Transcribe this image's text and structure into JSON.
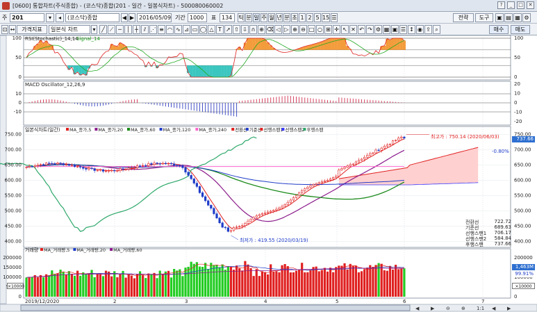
{
  "window": {
    "title": "[0600] 통합차트(주식종합) - (코스닥)종합(201 - 일간 - 일봉식차트) - 500080060002"
  },
  "toolbar1": {
    "market_label": "주",
    "code": "201",
    "name": "(코스닥)종합",
    "date": "2016/05/09",
    "period_label": "기간",
    "period_value": "1000",
    "count_label": "표",
    "count_value": "134",
    "intervals": [
      "틱",
      "분",
      "일",
      "주",
      "월",
      "년",
      "분",
      "초",
      "1",
      "2",
      "5",
      "15",
      "☰"
    ],
    "right_buttons": [
      "전략",
      "도구"
    ]
  },
  "toolbar2": {
    "sub_label1": "가격지표",
    "sub_label2": "일본식 차트",
    "right_buttons": [
      "매수",
      "매도"
    ]
  },
  "panes": {
    "rsi": {
      "title": "RSI(Stochastic)_14,14",
      "signal": "Signal_14",
      "ticks": [
        "100",
        "50",
        "0"
      ]
    },
    "macd": {
      "title": "MACD Oscillator_12,26,9",
      "ticks_left": [
        "10",
        "0",
        "-10"
      ],
      "ticks_right": [
        "20",
        "10",
        "0",
        "-10",
        "-20"
      ]
    },
    "price": {
      "title": "일본식차트(일간)",
      "legend": [
        "MA_종가,5",
        "MA_종가,20",
        "MA_종가,60",
        "MA_종가,120",
        "MA_종가,240",
        "전환선",
        "기준선",
        "선행스팬1",
        "선행스팬2",
        "후행스팬"
      ],
      "ticks": [
        "750.00",
        "700.00",
        "650.00",
        "600.00",
        "550.00",
        "500.00",
        "450.00",
        "400.00"
      ],
      "high_label": "최고가 : 750.14 (2020/06/03)",
      "low_label": "최저가 : 419.55 (2020/03/19)",
      "current_price": "737.66",
      "change_pct": "-0.80%"
    },
    "volume": {
      "title": "거래량",
      "legend": [
        "MA_거래량,5",
        "MA_거래량,20",
        "MA_거래량,60"
      ],
      "ticks": [
        "200000",
        "150000",
        "100000",
        "50000",
        "0"
      ],
      "unit": "×10000",
      "current_volume": "1,463M",
      "volume_pct": "99.91%"
    }
  },
  "ichimoku_values": [
    {
      "label": "전환선",
      "value": "722.72"
    },
    {
      "label": "기준선",
      "value": "689.63"
    },
    {
      "label": "선행스팬1",
      "value": "706.17"
    },
    {
      "label": "선행스팬2",
      "value": "584.84"
    },
    {
      "label": "후행스팬",
      "value": "737.66"
    }
  ],
  "xaxis": {
    "start": "2019/12/2020",
    "months": [
      "2",
      "3",
      "4",
      "5",
      "6",
      "7"
    ]
  },
  "colors": {
    "up": "#e02020",
    "down": "#1f3cc8",
    "vol_up": "#e02020",
    "vol_down": "#22cc22",
    "cloud": "#ffd0d0",
    "highlight": "#2d6fd0"
  }
}
